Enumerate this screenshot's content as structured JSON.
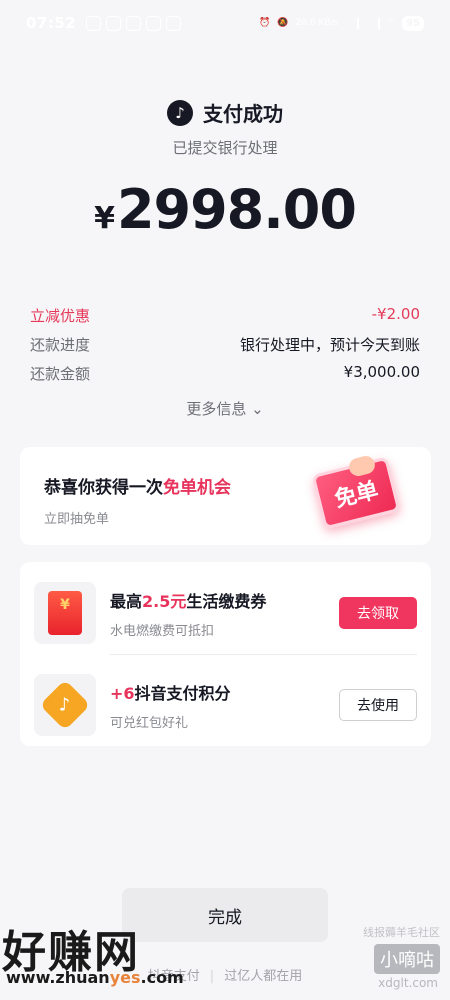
{
  "status_bar": {
    "time": "07:52",
    "net_speed": "20.0 KB/s",
    "battery": "95"
  },
  "header": {
    "logo_icon": "tiktok-icon",
    "title": "支付成功",
    "subtitle": "已提交银行处理",
    "currency": "¥",
    "amount": "2998.00"
  },
  "info_rows": [
    {
      "label": "立减优惠",
      "value": "-¥2.00"
    },
    {
      "label": "还款进度",
      "value": "银行处理中，预计今天到账"
    },
    {
      "label": "还款金额",
      "value": "¥3,000.00"
    }
  ],
  "more_info": "更多信息",
  "promo": {
    "title_prefix": "恭喜你获得一次",
    "title_highlight": "免单机会",
    "subtitle": "立即抽免单",
    "badge": "免单"
  },
  "rewards": [
    {
      "title_prefix": "最高",
      "title_highlight": "2.5元",
      "title_suffix": "生活缴费券",
      "subtitle": "水电燃缴费可抵扣",
      "button": "去领取",
      "icon_text": "¥"
    },
    {
      "title_prefix": "+6",
      "title_highlight": "",
      "title_suffix": "抖音支付积分",
      "subtitle": "可兑红包好礼",
      "button": "去使用",
      "icon_text": "♪"
    }
  ],
  "done_button": "完成",
  "footer": {
    "left": "抖音支付",
    "right": "过亿人都在用"
  },
  "watermarks": {
    "left_big": "好赚网",
    "left_url_a": "www.zhuan",
    "left_url_b": "yes",
    "left_url_c": ".com",
    "right_top": "线报薅羊毛社区",
    "right_mid": "小嘀咕",
    "right_url": "xdglt.com"
  },
  "colors": {
    "accent": "#f0355e",
    "discount": "#e53a5a",
    "background": "#f6f6f8"
  }
}
